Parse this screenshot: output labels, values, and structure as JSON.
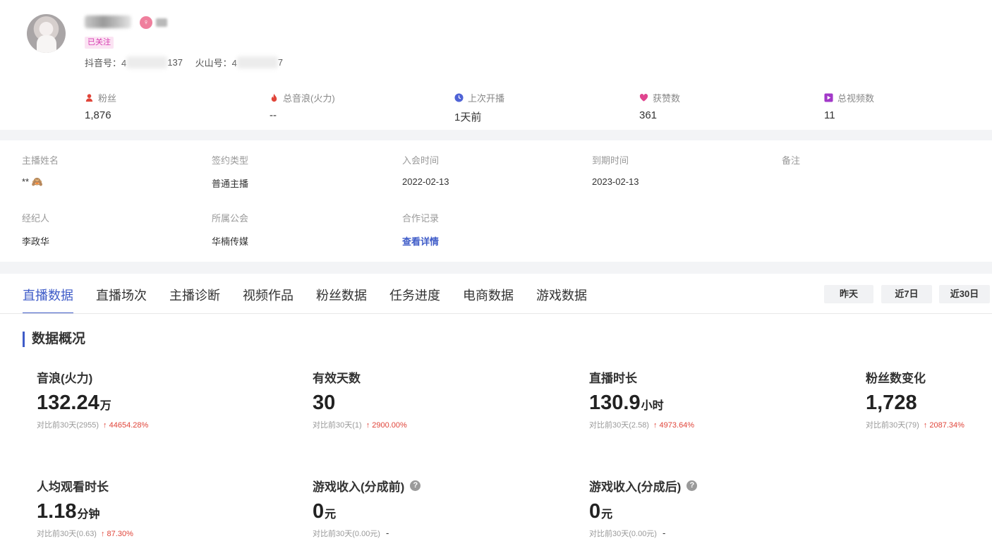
{
  "profile": {
    "follow_badge": "已关注",
    "douyin_prefix": "抖音号：4",
    "douyin_suffix": "137",
    "huoshan_prefix": "火山号：4",
    "huoshan_suffix": "7",
    "gender_symbol": "♀"
  },
  "stats": [
    {
      "label": "粉丝",
      "value": "1,876",
      "icon": "fans-icon",
      "color": "#e0453a"
    },
    {
      "label": "总音浪(火力)",
      "value": "--",
      "icon": "flame-icon",
      "color": "#e0453a"
    },
    {
      "label": "上次开播",
      "value": "1天前",
      "icon": "clock-icon",
      "color": "#4f63d6"
    },
    {
      "label": "获赞数",
      "value": "361",
      "icon": "heart-icon",
      "color": "#e0458f"
    },
    {
      "label": "总视频数",
      "value": "11",
      "icon": "video-icon",
      "color": "#a239c8"
    }
  ],
  "info": {
    "anchor_name": {
      "label": "主播姓名",
      "value": "** 🙈"
    },
    "contract_type": {
      "label": "签约类型",
      "value": "普通主播"
    },
    "join_time": {
      "label": "入会时间",
      "value": "2022-02-13"
    },
    "expire_time": {
      "label": "到期时间",
      "value": "2023-02-13"
    },
    "remark": {
      "label": "备注",
      "value": ""
    },
    "agent": {
      "label": "经纪人",
      "value": "李政华"
    },
    "guild": {
      "label": "所属公会",
      "value": "华楠传媒"
    },
    "coop": {
      "label": "合作记录",
      "value": "查看详情"
    }
  },
  "tabs": [
    "直播数据",
    "直播场次",
    "主播诊断",
    "视频作品",
    "粉丝数据",
    "任务进度",
    "电商数据",
    "游戏数据"
  ],
  "ranges": [
    "昨天",
    "近7日",
    "近30日"
  ],
  "section_title": "数据概况",
  "metrics": [
    {
      "title": "音浪(火力)",
      "value": "132.24",
      "unit": "万",
      "compare": "对比前30天(2955)",
      "change": "↑ 44654.28%"
    },
    {
      "title": "有效天数",
      "value": "30",
      "unit": "",
      "compare": "对比前30天(1)",
      "change": "↑ 2900.00%"
    },
    {
      "title": "直播时长",
      "value": "130.9",
      "unit": "小时",
      "compare": "对比前30天(2.58)",
      "change": "↑ 4973.64%"
    },
    {
      "title": "粉丝数变化",
      "value": "1,728",
      "unit": "",
      "compare": "对比前30天(79)",
      "change": "↑ 2087.34%"
    },
    {
      "title": "人均观看时长",
      "value": "1.18",
      "unit": "分钟",
      "compare": "对比前30天(0.63)",
      "change": "↑ 87.30%"
    },
    {
      "title": "游戏收入(分成前)",
      "value": "0",
      "unit": "元",
      "compare": "对比前30天(0.00元)",
      "change": "-"
    },
    {
      "title": "游戏收入(分成后)",
      "value": "0",
      "unit": "元",
      "compare": "对比前30天(0.00元)",
      "change": "-"
    }
  ]
}
